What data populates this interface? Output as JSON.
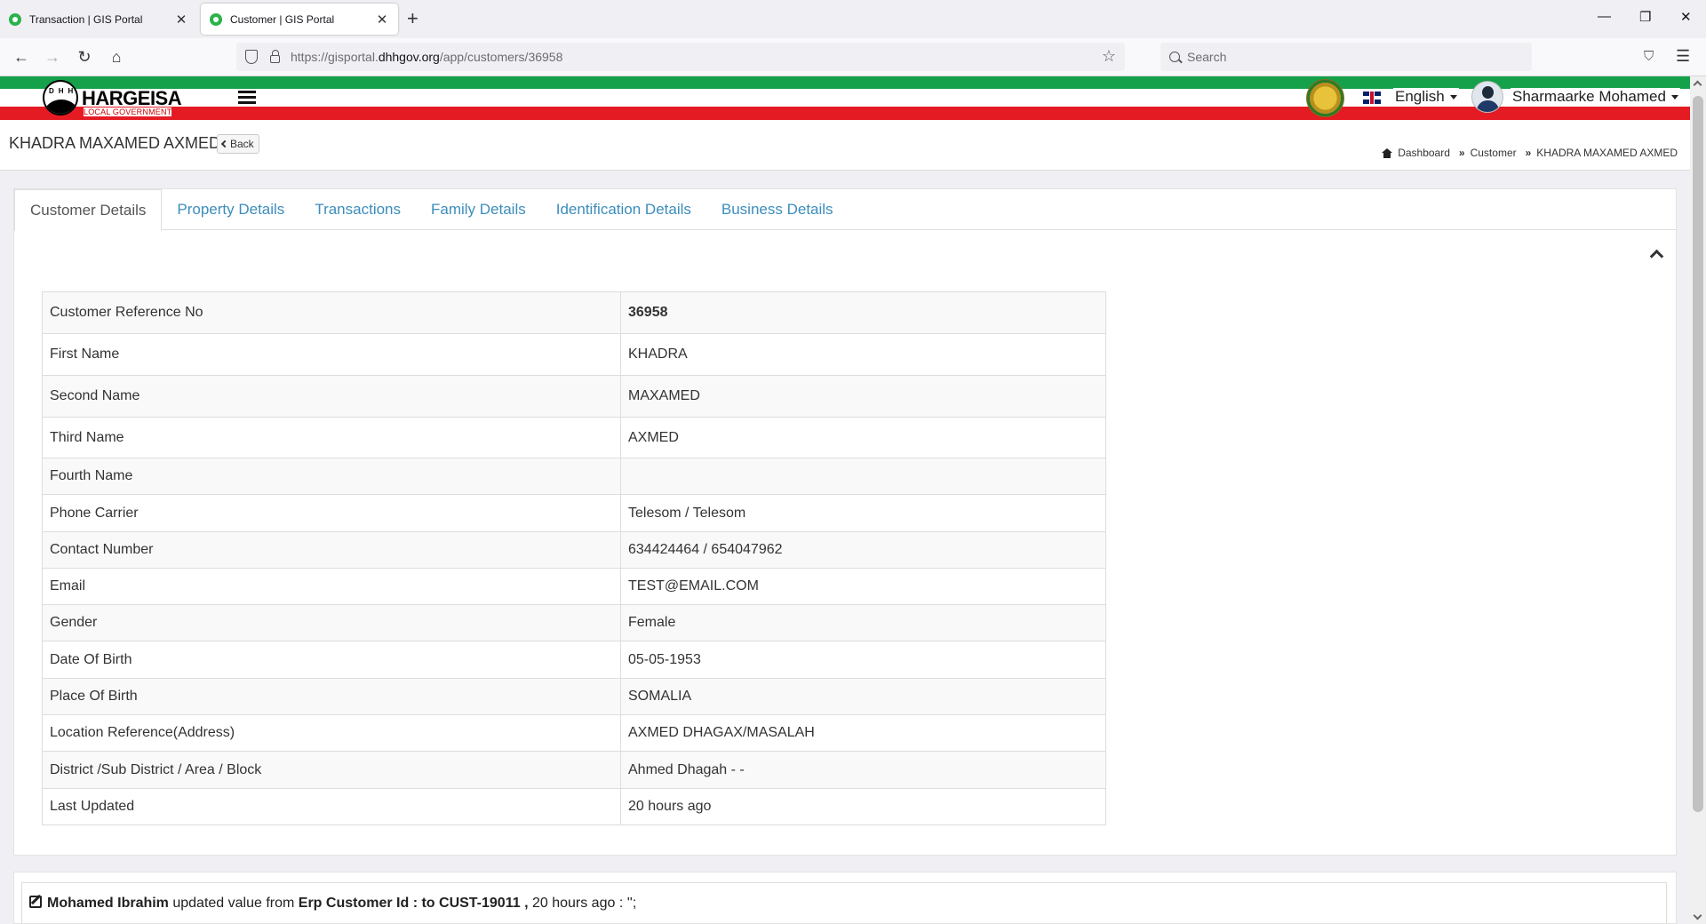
{
  "browser": {
    "tabs": [
      {
        "title": "Transaction | GIS Portal",
        "active": false
      },
      {
        "title": "Customer | GIS Portal",
        "active": true
      }
    ],
    "url_prefix": "https://gisportal.",
    "url_domain": "dhhgov.org",
    "url_path": "/app/customers/36958",
    "search_placeholder": "Search"
  },
  "header": {
    "logo_disc_letters": "DHH",
    "logo_text": "HARGEISA",
    "logo_subtext": "LOCAL GOVERNMENT",
    "language": "English",
    "user_name": "Sharmaarke Mohamed",
    "colors": {
      "green": "#14a14a",
      "red": "#e51b24"
    }
  },
  "page": {
    "title": "KHADRA MAXAMED AXMED",
    "back_label": "Back",
    "breadcrumb": [
      "Dashboard",
      "Customer",
      "KHADRA MAXAMED AXMED"
    ]
  },
  "tabs": [
    "Customer Details",
    "Property Details",
    "Transactions",
    "Family Details",
    "Identification Details",
    "Business Details"
  ],
  "customer": {
    "rows": [
      {
        "label": "Customer Reference No",
        "value": "36958"
      },
      {
        "label": "First Name",
        "value": "KHADRA"
      },
      {
        "label": "Second Name",
        "value": "MAXAMED"
      },
      {
        "label": "Third Name",
        "value": "AXMED"
      },
      {
        "label": "Fourth Name",
        "value": ""
      },
      {
        "label": "Phone Carrier",
        "value": "Telesom / Telesom"
      },
      {
        "label": "Contact Number",
        "value": "634424464 / 654047962"
      },
      {
        "label": "Email",
        "value": "TEST@EMAIL.COM"
      },
      {
        "label": "Gender",
        "value": "Female"
      },
      {
        "label": "Date Of Birth",
        "value": "05-05-1953"
      },
      {
        "label": "Place Of Birth",
        "value": "SOMALIA"
      },
      {
        "label": "Location Reference(Address)",
        "value": "AXMED DHAGAX/MASALAH"
      },
      {
        "label": "District /Sub District / Area / Block",
        "value": "Ahmed Dhagah - -"
      },
      {
        "label": "Last Updated",
        "value": "20 hours ago"
      }
    ]
  },
  "activity": {
    "user": "Mohamed Ibrahim",
    "text1": " updated value from ",
    "field": "Erp Customer Id : to CUST-19011 ,",
    "text2": " 20 hours ago : '';"
  }
}
